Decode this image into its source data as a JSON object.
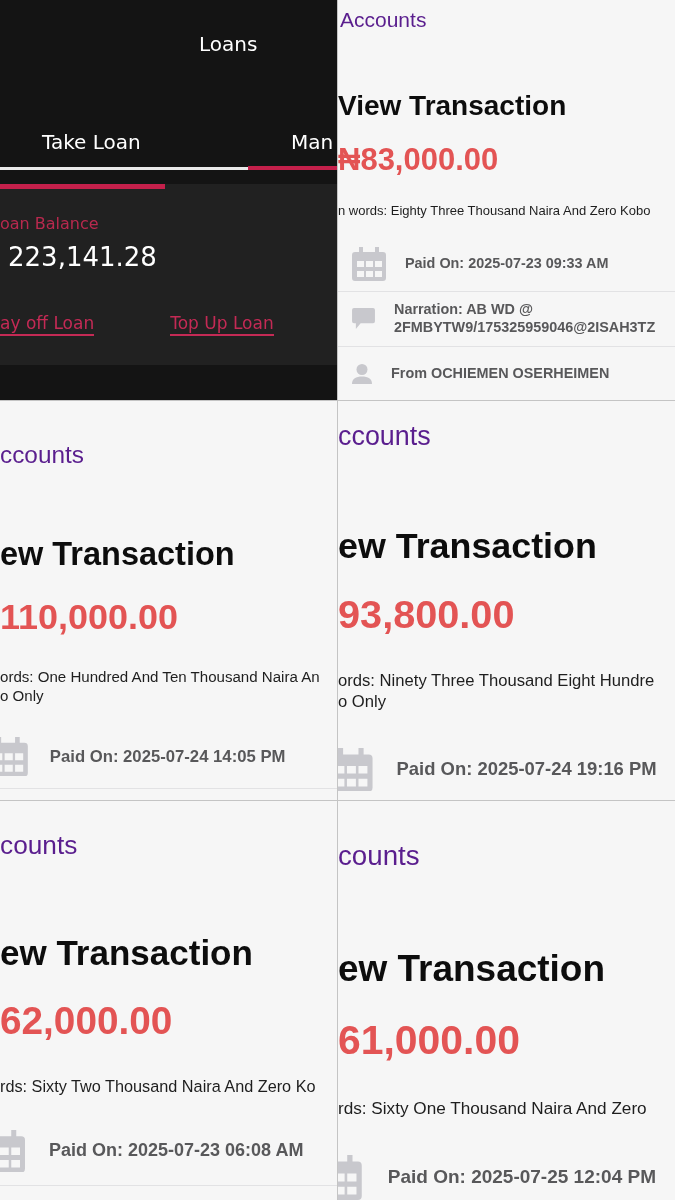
{
  "panels": [
    {
      "kind": "loans",
      "title": "Loans",
      "tabs": [
        {
          "label": "Take Loan",
          "selected": false
        },
        {
          "label": "Man",
          "selected": true
        }
      ],
      "balance_label": "oan Balance",
      "balance": "223,141.28",
      "actions": [
        "ay off Loan",
        "Top Up Loan"
      ]
    },
    {
      "kind": "transaction",
      "back_link": "Accounts",
      "heading": "View Transaction",
      "amount": "₦83,000.00",
      "words": [
        "n words: Eighty Three Thousand Naira And Zero Kobo"
      ],
      "details": [
        {
          "kind": "date",
          "text": "Paid On: 2025-07-23 09:33 AM"
        },
        {
          "kind": "narration",
          "text": "Narration: AB WD @ 2FMBYTW9/175325959046@2ISAH3TZ"
        },
        {
          "kind": "sender",
          "text": "From OCHIEMEN OSERHEIMEN"
        }
      ]
    },
    {
      "kind": "transaction",
      "back_link": "ccounts",
      "heading": "ew Transaction",
      "amount": "110,000.00",
      "words": [
        "ords: One Hundred And Ten Thousand Naira An",
        "o Only"
      ],
      "details": [
        {
          "kind": "date",
          "text": "Paid On: 2025-07-24 14:05 PM"
        }
      ]
    },
    {
      "kind": "transaction",
      "back_link": "ccounts",
      "heading": "ew Transaction",
      "amount": "93,800.00",
      "words": [
        "ords: Ninety Three Thousand Eight Hundre",
        "o Only"
      ],
      "details": [
        {
          "kind": "date",
          "text": "Paid On: 2025-07-24 19:16 PM"
        }
      ]
    },
    {
      "kind": "transaction",
      "back_link": "counts",
      "heading": "ew Transaction",
      "amount": "62,000.00",
      "words": [
        "rds: Sixty Two Thousand Naira And Zero Ko"
      ],
      "details": [
        {
          "kind": "date",
          "text": "Paid On: 2025-07-23 06:08 AM"
        }
      ]
    },
    {
      "kind": "transaction",
      "back_link": "counts",
      "heading": "ew Transaction",
      "amount": "61,000.00",
      "words": [
        "rds: Sixty One Thousand Naira And Zero"
      ],
      "details": [
        {
          "kind": "date",
          "text": "Paid On: 2025-07-25 12:04 PM"
        }
      ]
    }
  ]
}
